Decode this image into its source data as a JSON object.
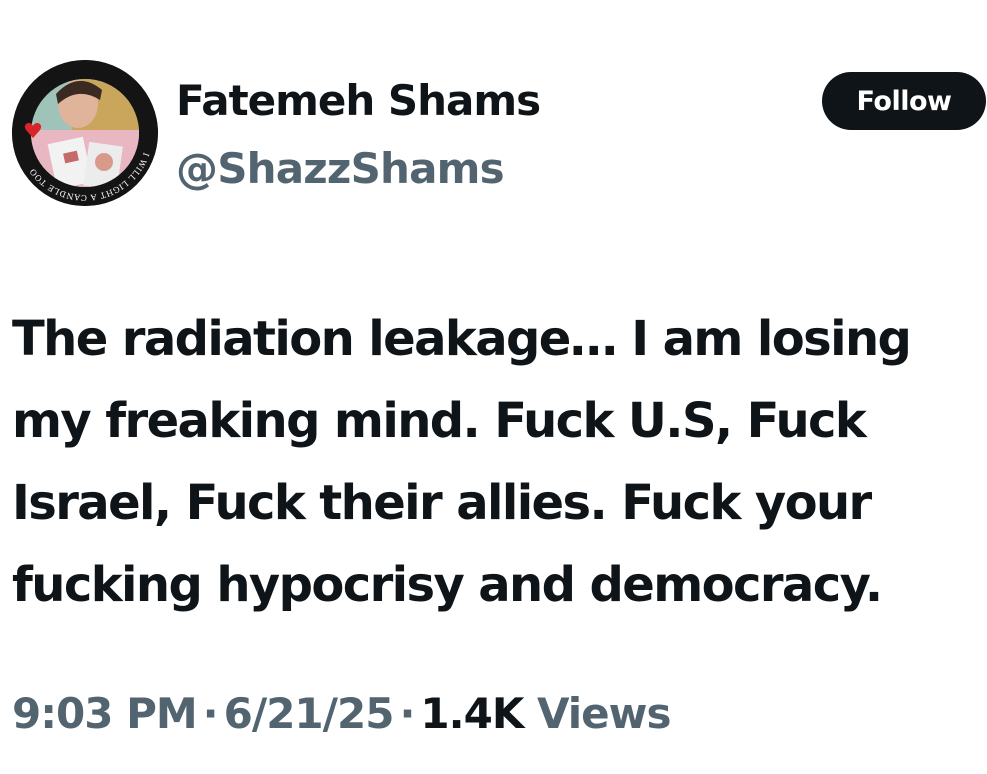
{
  "author": {
    "name": "Fatemeh Shams",
    "handle": "@ShazzShams",
    "avatar_ring_text": "I WILL LIGHT A CANDLE TOO"
  },
  "actions": {
    "follow_label": "Follow"
  },
  "tweet": {
    "lines": [
      "The radiation leakage… I am losing",
      "my freaking mind. Fuck U.S, Fuck",
      "Israel, Fuck their allies. Fuck your",
      "fucking hypocrisy and democracy."
    ]
  },
  "meta": {
    "time": "9:03 PM",
    "separator": "·",
    "date": "6/21/25",
    "views_count": "1.4K",
    "views_label": "Views"
  },
  "colors": {
    "text_primary": "#0f1419",
    "text_secondary": "#536471",
    "button_bg": "#0f1419",
    "button_text": "#ffffff",
    "background": "#ffffff"
  }
}
